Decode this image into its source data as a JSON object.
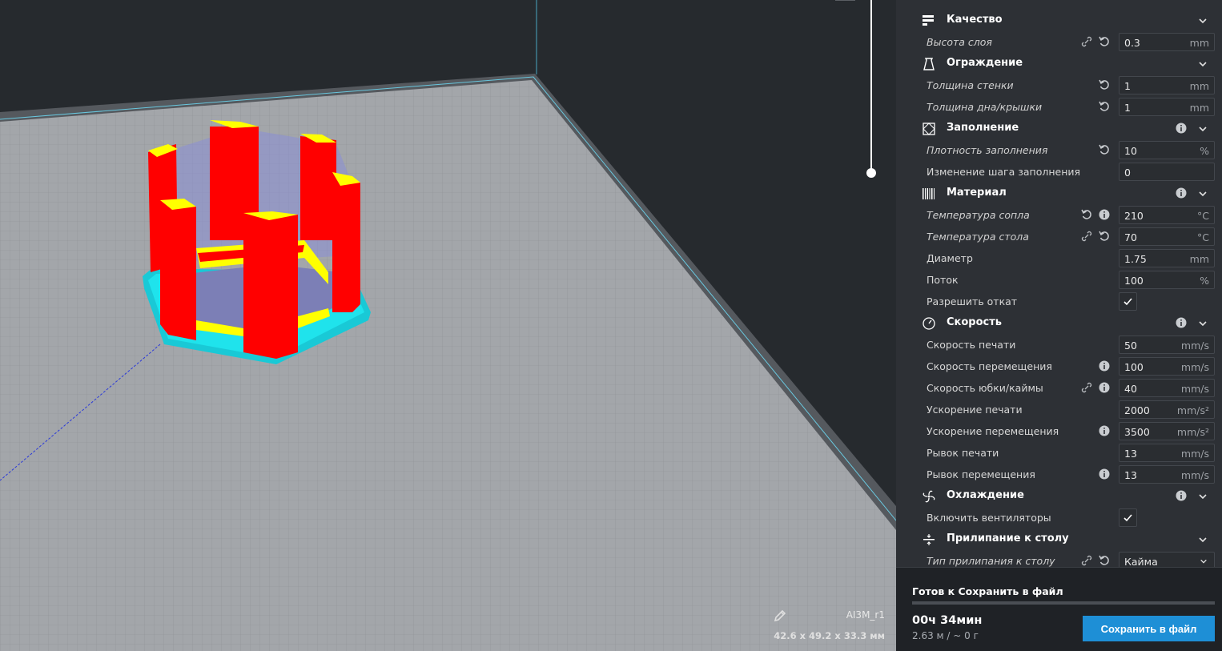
{
  "viewport": {
    "object_name": "AI3M_r1",
    "dimensions": "42.6 x 49.2 x 33.3 мм"
  },
  "sections": [
    {
      "key": "quality",
      "title": "Качество",
      "icon": "quality-icon",
      "info": false
    },
    {
      "key": "shell",
      "title": "Ограждение",
      "icon": "shell-icon",
      "info": false
    },
    {
      "key": "infill",
      "title": "Заполнение",
      "icon": "infill-icon",
      "info": true
    },
    {
      "key": "material",
      "title": "Материал",
      "icon": "material-icon",
      "info": true
    },
    {
      "key": "speed",
      "title": "Скорость",
      "icon": "speed-icon",
      "info": true
    },
    {
      "key": "cooling",
      "title": "Охлаждение",
      "icon": "cooling-icon",
      "info": true
    },
    {
      "key": "adhesion",
      "title": "Прилипание к столу",
      "icon": "adhesion-icon",
      "info": false
    }
  ],
  "settings": {
    "layer_height": {
      "label": "Высота слоя",
      "value": "0.3",
      "unit": "mm"
    },
    "wall_thickness": {
      "label": "Толщина стенки",
      "value": "1",
      "unit": "mm"
    },
    "top_bottom_thickness": {
      "label": "Толщина дна/крышки",
      "value": "1",
      "unit": "mm"
    },
    "infill_density": {
      "label": "Плотность заполнения",
      "value": "10",
      "unit": "%"
    },
    "gradual_infill": {
      "label": "Изменение шага заполнения",
      "value": "0",
      "unit": ""
    },
    "nozzle_temp": {
      "label": "Температура сопла",
      "value": "210",
      "unit": "°C"
    },
    "bed_temp": {
      "label": "Температура стола",
      "value": "70",
      "unit": "°C"
    },
    "diameter": {
      "label": "Диаметр",
      "value": "1.75",
      "unit": "mm"
    },
    "flow": {
      "label": "Поток",
      "value": "100",
      "unit": "%"
    },
    "retraction": {
      "label": "Разрешить откат",
      "checked": true
    },
    "print_speed": {
      "label": "Скорость печати",
      "value": "50",
      "unit": "mm/s"
    },
    "travel_speed": {
      "label": "Скорость перемещения",
      "value": "100",
      "unit": "mm/s"
    },
    "skirt_speed": {
      "label": "Скорость юбки/каймы",
      "value": "40",
      "unit": "mm/s"
    },
    "print_accel": {
      "label": "Ускорение печати",
      "value": "2000",
      "unit": "mm/s²"
    },
    "travel_accel": {
      "label": "Ускорение перемещения",
      "value": "3500",
      "unit": "mm/s²"
    },
    "print_jerk": {
      "label": "Рывок печати",
      "value": "13",
      "unit": "mm/s"
    },
    "travel_jerk": {
      "label": "Рывок перемещения",
      "value": "13",
      "unit": "mm/s"
    },
    "fans": {
      "label": "Включить вентиляторы",
      "checked": true
    },
    "adhesion_type": {
      "label": "Тип прилипания к столу",
      "value": "Кайма"
    }
  },
  "bottom": {
    "status": "Готов к Сохранить в файл",
    "time": "00ч 34мин",
    "material": "2.63 м / ~ 0 г",
    "save_label": "Сохранить в файл"
  },
  "colors": {
    "accent": "#1e8fd6",
    "model": "#ff0000",
    "skin": "#ffff00",
    "skirt": "#00ffff",
    "travel": "#0000ff"
  }
}
